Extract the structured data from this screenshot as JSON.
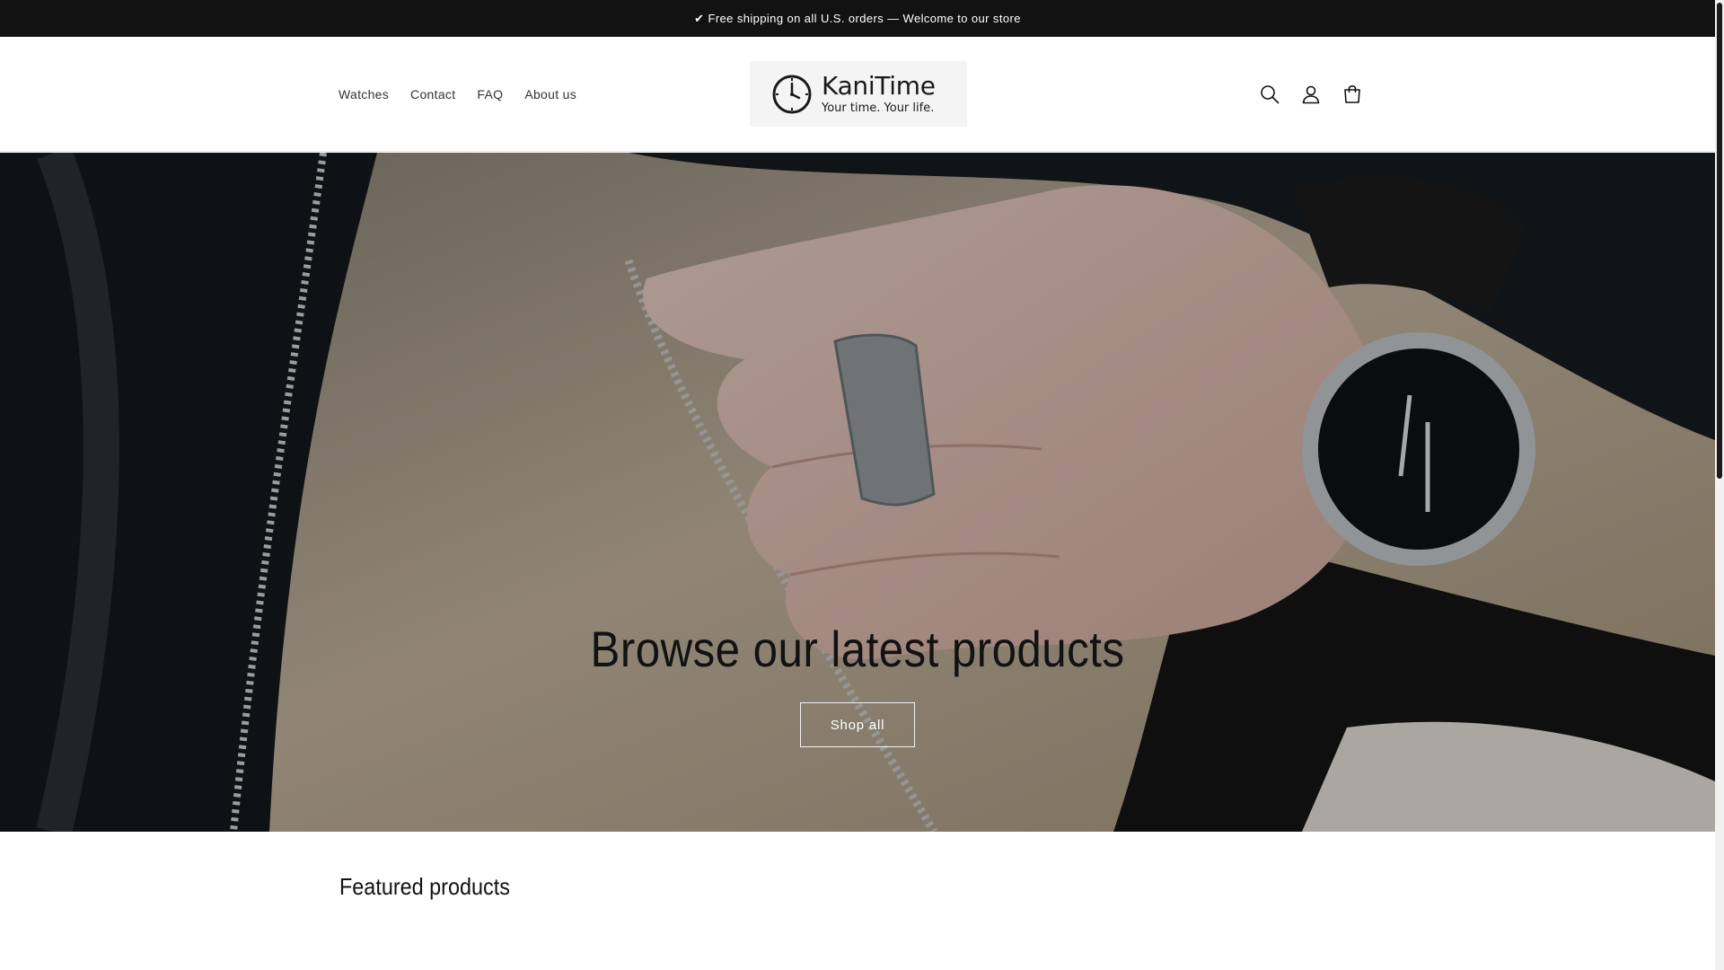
{
  "announcement": {
    "text": "✔ Free shipping on all U.S. orders — Welcome to our store"
  },
  "header": {
    "nav": [
      {
        "label": "Watches"
      },
      {
        "label": "Contact"
      },
      {
        "label": "FAQ"
      },
      {
        "label": "About us"
      }
    ],
    "logo": {
      "name": "KaniTime",
      "tagline": "Your time. Your life."
    },
    "icons": [
      "search-icon",
      "account-icon",
      "cart-icon"
    ]
  },
  "hero": {
    "title": "Browse our latest products",
    "button_label": "Shop all"
  },
  "featured": {
    "title": "Featured products"
  },
  "colors": {
    "announcement_bg": "#121212",
    "text": "#121212",
    "hero_overlay": "rgba(0,0,0,0.28)"
  }
}
